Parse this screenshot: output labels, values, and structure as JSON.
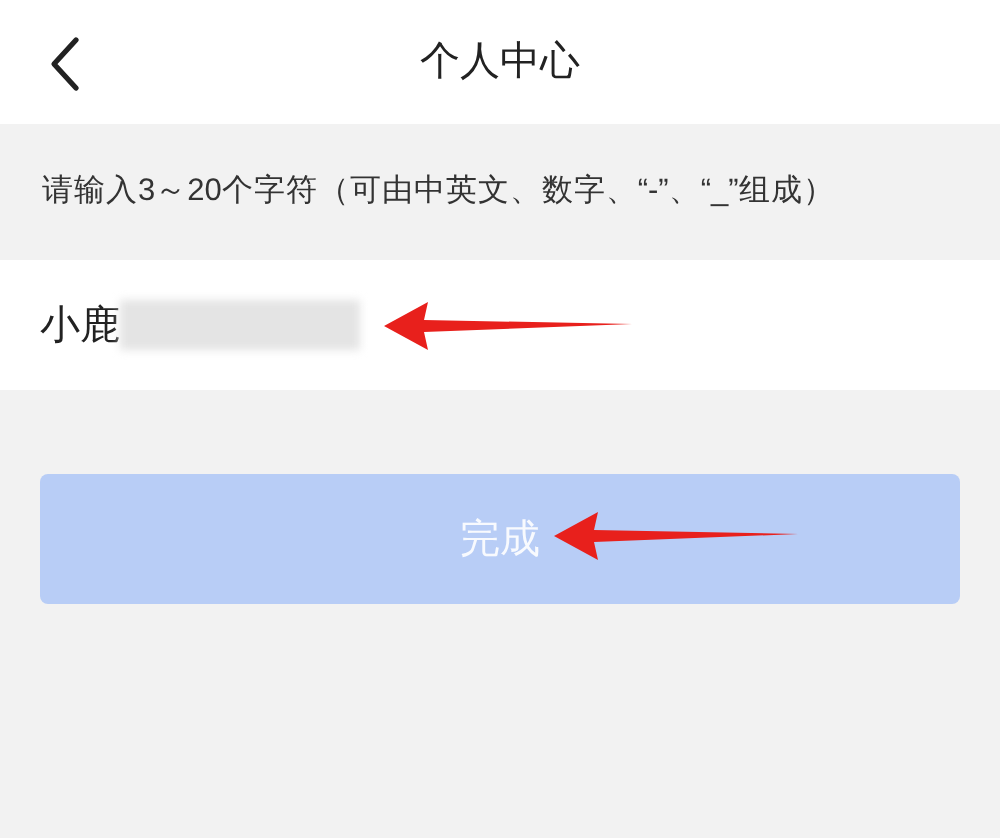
{
  "header": {
    "title": "个人中心"
  },
  "hint": "请输入3～20个字符（可由中英文、数字、“-”、“_”组成）",
  "name_field": {
    "value": "小鹿"
  },
  "done_button": {
    "label": "完成",
    "disabled": true
  }
}
